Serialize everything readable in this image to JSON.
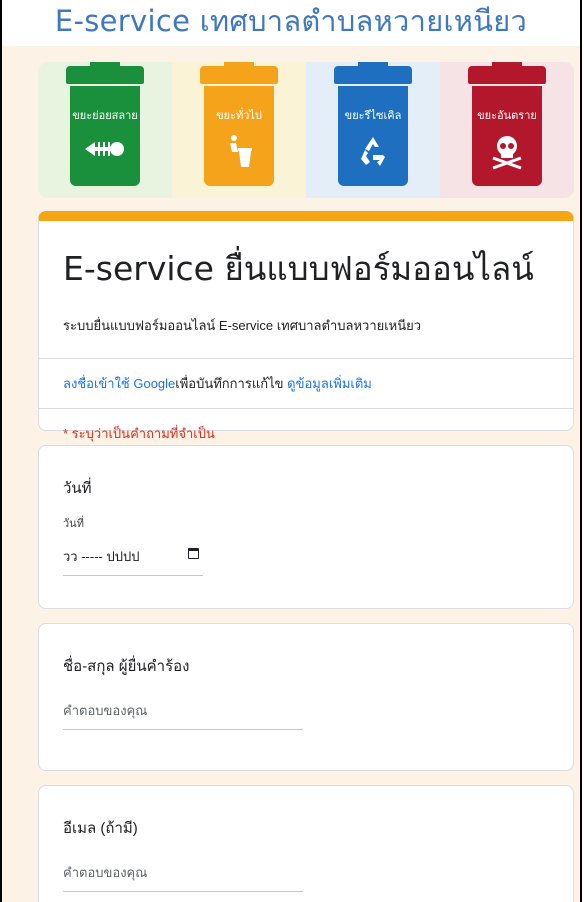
{
  "header": {
    "title": "E-service เทศบาลตำบลหวายเหนียว"
  },
  "banner": {
    "bins": [
      {
        "label": "ขยะย่อยสลาย",
        "icon": "fish-bone-icon",
        "color": "#1a8f3c",
        "bg": "#e8f3e0"
      },
      {
        "label": "ขยะทั่วไป",
        "icon": "trash-can-icon",
        "color": "#f4a31b",
        "bg": "#fbf3d6"
      },
      {
        "label": "ขยะรีไซเคิล",
        "icon": "recycle-icon",
        "color": "#1f6fc0",
        "bg": "#e3eef8"
      },
      {
        "label": "ขยะอันตราย",
        "icon": "skull-icon",
        "color": "#b3172c",
        "bg": "#f6e3e5"
      }
    ]
  },
  "form": {
    "title": "E-service ยื่นแบบฟอร์มออนไลน์",
    "description": "ระบบยื่นแบบฟอร์มออนไลน์ E-service เทศบาลตำบลหวายเหนียว",
    "signin_link": "ลงชื่อเข้าใช้ Google",
    "signin_text": "เพื่อบันทึกการแก้ไข",
    "more_info_link": "ดูข้อมูลเพิ่มเติม",
    "required_note": "* ระบุว่าเป็นคำถามที่จำเป็น"
  },
  "questions": {
    "date": {
      "title": "วันที่",
      "sublabel": "วันที่",
      "placeholder": "วว ----- ปปปป"
    },
    "name": {
      "title": "ชื่อ-สกุล ผู้ยื่นคำร้อง",
      "placeholder": "คำตอบของคุณ"
    },
    "email": {
      "title": "อีเมล (ถ้ามี)",
      "placeholder": "คำตอบของคุณ"
    }
  },
  "colors": {
    "accent": "#f7a514",
    "link": "#1a73e8",
    "required": "#d93025",
    "page_bg": "#fdf2e6"
  }
}
